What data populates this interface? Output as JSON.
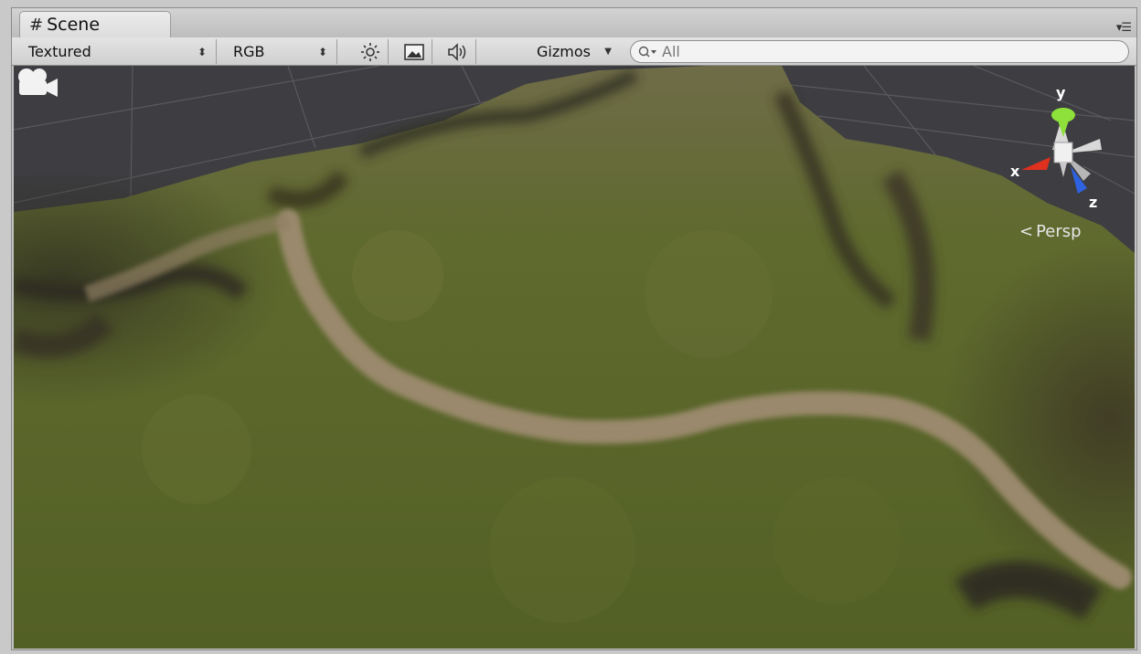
{
  "tab": {
    "title": "Scene",
    "icon": "hash-icon"
  },
  "toolbar": {
    "render_mode": "Textured",
    "channel_mode": "RGB",
    "lighting_icon": "sun-icon",
    "image_icon": "image-icon",
    "audio_icon": "speaker-icon",
    "gizmos_label": "Gizmos",
    "search_value": "All"
  },
  "viewport": {
    "camera_icon": "camera-icon",
    "gizmo": {
      "x_label": "x",
      "y_label": "y",
      "z_label": "z"
    },
    "projection_label": "Persp"
  },
  "colors": {
    "grass": "#5e6b2c",
    "path": "#9c8a6e",
    "grid_bg": "#3f3f43",
    "gizmo_x": "#e0301e",
    "gizmo_y": "#8ee03a",
    "gizmo_z": "#2e62e0"
  }
}
